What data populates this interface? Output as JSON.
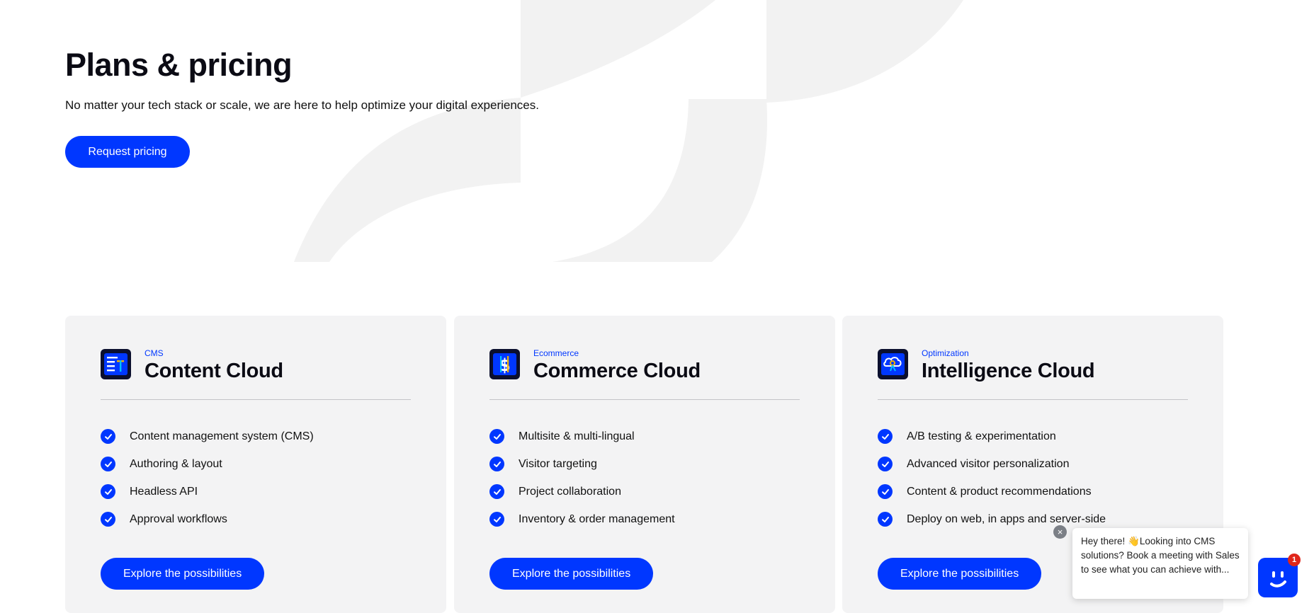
{
  "hero": {
    "title": "Plans & pricing",
    "subtitle": "No matter your tech stack or scale, we are here to help optimize your digital experiences.",
    "cta": "Request pricing"
  },
  "cards": [
    {
      "eyebrow": "CMS",
      "title": "Content Cloud",
      "icon": "content-cloud-icon",
      "features": [
        "Content management system (CMS)",
        "Authoring & layout",
        "Headless API",
        "Approval workflows"
      ],
      "cta": "Explore the possibilities"
    },
    {
      "eyebrow": "Ecommerce",
      "title": "Commerce Cloud",
      "icon": "commerce-cloud-icon",
      "features": [
        "Multisite & multi-lingual",
        "Visitor targeting",
        "Project collaboration",
        "Inventory & order management"
      ],
      "cta": "Explore the possibilities"
    },
    {
      "eyebrow": "Optimization",
      "title": "Intelligence Cloud",
      "icon": "intelligence-cloud-icon",
      "features": [
        "A/B testing & experimentation",
        "Advanced visitor personalization",
        "Content & product recommendations",
        "Deploy on web, in apps and server-side"
      ],
      "cta": "Explore the possibilities"
    }
  ],
  "chat": {
    "message": "Hey there! 👋Looking into CMS solutions? Book a meeting with Sales to see what you can achieve with...",
    "badge_count": "1"
  },
  "colors": {
    "accent": "#0037ff",
    "card_bg": "#f3f3f4",
    "badge": "#e0261a"
  }
}
